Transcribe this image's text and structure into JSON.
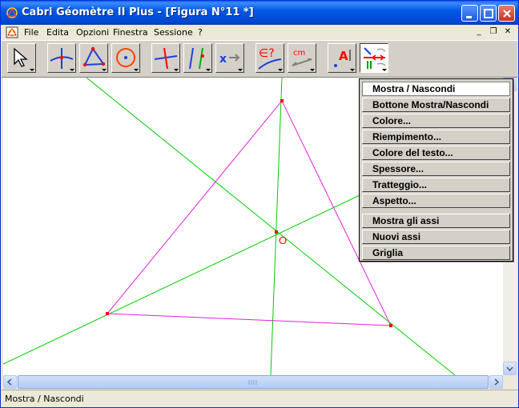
{
  "window": {
    "title": "Cabri Géomètre II Plus - [Figura N°11 *]"
  },
  "menubar": {
    "items": [
      "File",
      "Edita",
      "Opzioni",
      "Finestra",
      "Sessione",
      "?"
    ]
  },
  "toolbar": {
    "tools": [
      {
        "name": "pointer-tool-icon"
      },
      {
        "name": "lines-tool-icon"
      },
      {
        "name": "polygon-tool-icon"
      },
      {
        "name": "circle-tool-icon"
      },
      {
        "name": "perpendicular-tool-icon"
      },
      {
        "name": "parallel-tool-icon"
      },
      {
        "name": "transform-tool-icon"
      },
      {
        "name": "membership-check-tool-icon"
      },
      {
        "name": "measure-tool-icon"
      },
      {
        "name": "text-tool-icon"
      },
      {
        "name": "attributes-tool-icon",
        "pressed": true
      }
    ]
  },
  "canvas": {
    "point_label": "O",
    "colors": {
      "lines": "#00cc00",
      "triangle": "#e020e0",
      "points": "#ff0000",
      "label": "#ff0000"
    }
  },
  "popup_menu": {
    "items": [
      "Mostra / Nascondi",
      "Bottone Mostra/Nascondi",
      "Colore...",
      "Riempimento...",
      "Colore del testo...",
      "Spessore...",
      "Tratteggio...",
      "Aspetto...",
      "Mostra gli assi",
      "Nuovi assi",
      "Griglia"
    ],
    "selected_index": 0
  },
  "statusbar": {
    "text": "Mostra / Nascondi"
  },
  "mdi_controls": [
    "_",
    "❐",
    "✕"
  ]
}
